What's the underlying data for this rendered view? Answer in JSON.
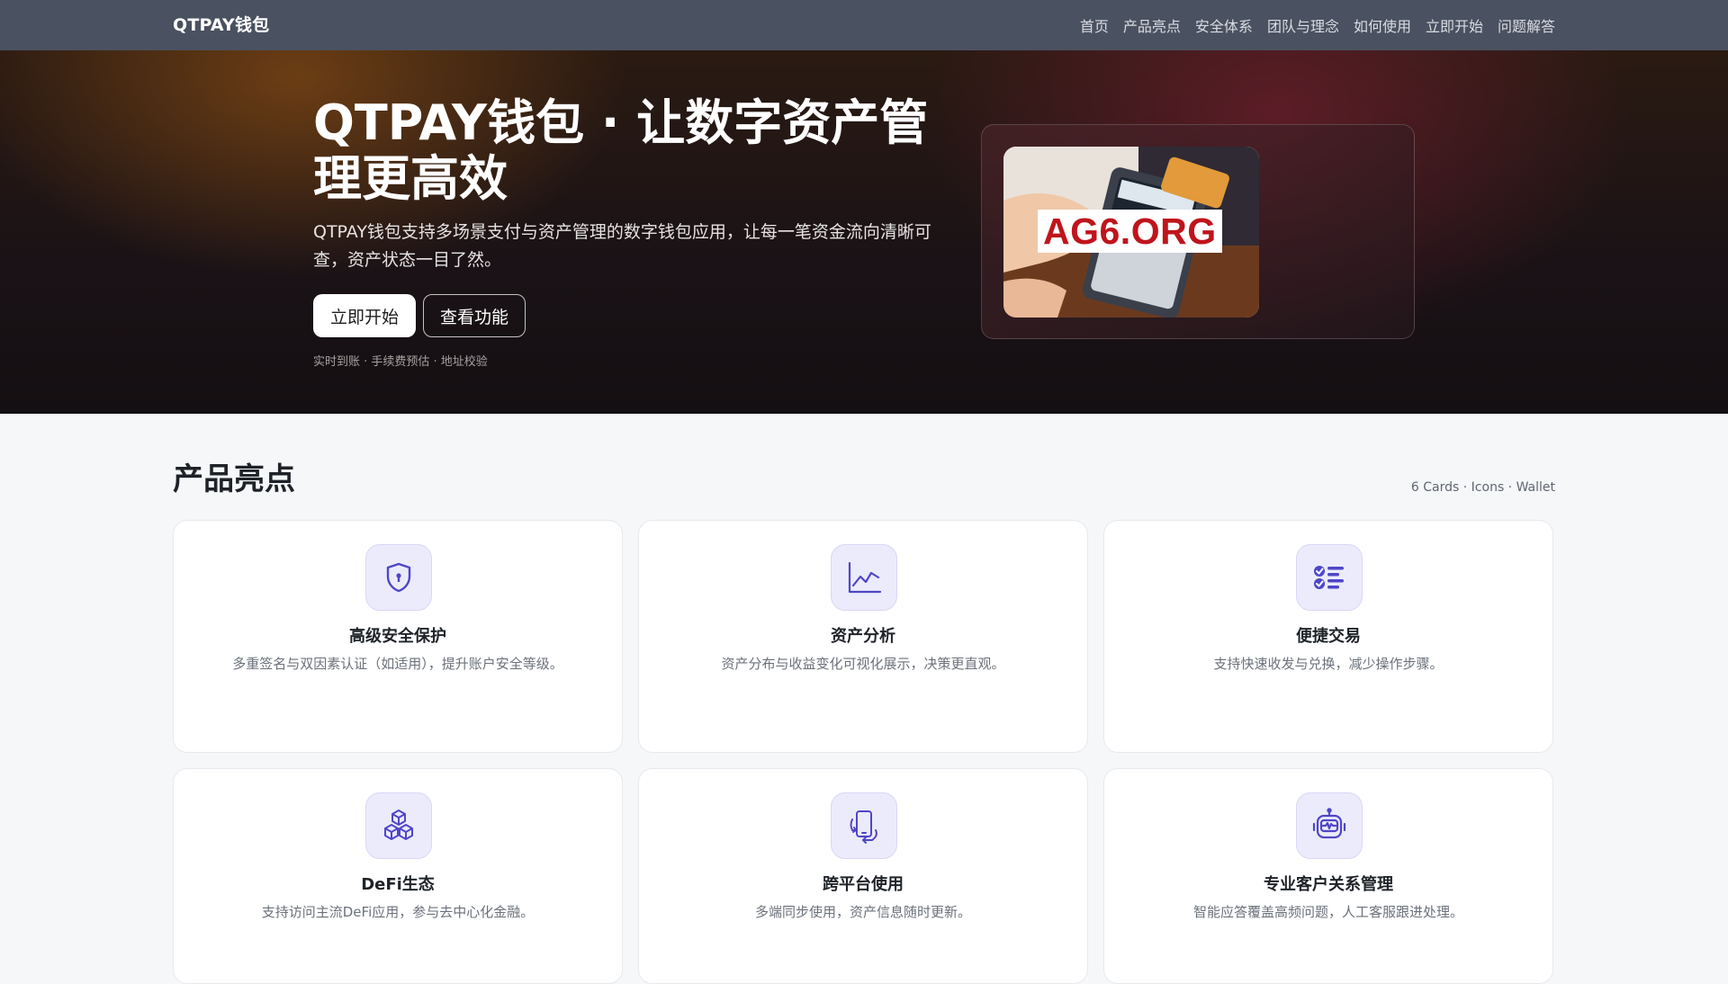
{
  "nav": {
    "brand": "QTPAY钱包",
    "links": [
      "首页",
      "产品亮点",
      "安全体系",
      "团队与理念",
      "如何使用",
      "立即开始",
      "问题解答"
    ]
  },
  "hero": {
    "title": "QTPAY钱包 · 让数字资产管理更高效",
    "description": "QTPAY钱包支持多场景支付与资产管理的数字钱包应用，让每一笔资金流向清晰可查，资产状态一目了然。",
    "primary_button": "立即开始",
    "secondary_button": "查看功能",
    "note": "实时到账 · 手续费预估 · 地址校验",
    "image_label": "AG6.ORG"
  },
  "features": {
    "title": "产品亮点",
    "meta": "6 Cards · Icons · Wallet",
    "cards": [
      {
        "icon": "shield-lock-icon",
        "title": "高级安全保护",
        "desc": "多重签名与双因素认证（如适用），提升账户安全等级。"
      },
      {
        "icon": "line-chart-icon",
        "title": "资产分析",
        "desc": "资产分布与收益变化可视化展示，决策更直观。"
      },
      {
        "icon": "checklist-icon",
        "title": "便捷交易",
        "desc": "支持快速收发与兑换，减少操作步骤。"
      },
      {
        "icon": "cubes-icon",
        "title": "DeFi生态",
        "desc": "支持访问主流DeFi应用，参与去中心化金融。"
      },
      {
        "icon": "device-sync-icon",
        "title": "跨平台使用",
        "desc": "多端同步使用，资产信息随时更新。"
      },
      {
        "icon": "robot-icon",
        "title": "专业客户关系管理",
        "desc": "智能应答覆盖高频问题，人工客服跟进处理。"
      }
    ]
  },
  "colors": {
    "accent": "#4f46c8",
    "navbar": "#4a5160",
    "image_label_text": "#c0141c"
  }
}
